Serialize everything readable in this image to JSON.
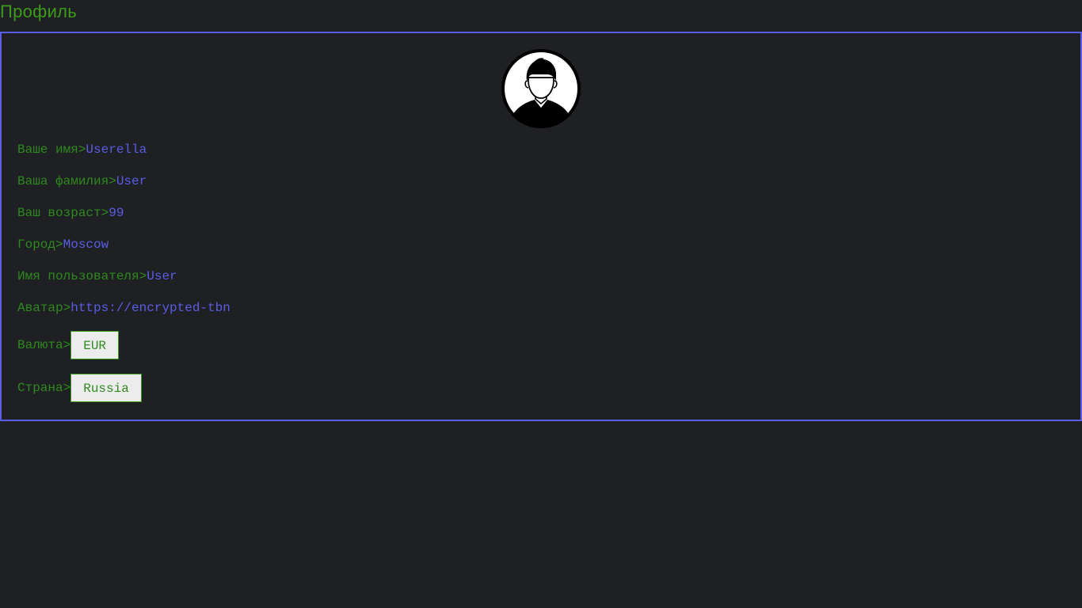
{
  "page": {
    "title": "Профиль"
  },
  "avatar": {
    "icon": "user-avatar-icon"
  },
  "fields": [
    {
      "label": "Ваше имя>",
      "value": "Userella"
    },
    {
      "label": "Ваша фамилия>",
      "value": "User"
    },
    {
      "label": "Ваш возраст>",
      "value": "99"
    },
    {
      "label": "Город>",
      "value": "Moscow"
    },
    {
      "label": "Имя пользователя>",
      "value": "User"
    },
    {
      "label": "Аватар>",
      "value": "https://encrypted-tbn"
    }
  ],
  "currency": {
    "label": "Валюта>",
    "selected": "EUR"
  },
  "country": {
    "label": "Страна>",
    "selected": "Russia"
  },
  "colors": {
    "background": "#1f2023",
    "accent_green": "#3d9b1c",
    "label_green": "#2f8a1f",
    "value_blue": "#5a5ee6",
    "border_blue": "#5a5ee6",
    "select_bg": "#ececec"
  }
}
